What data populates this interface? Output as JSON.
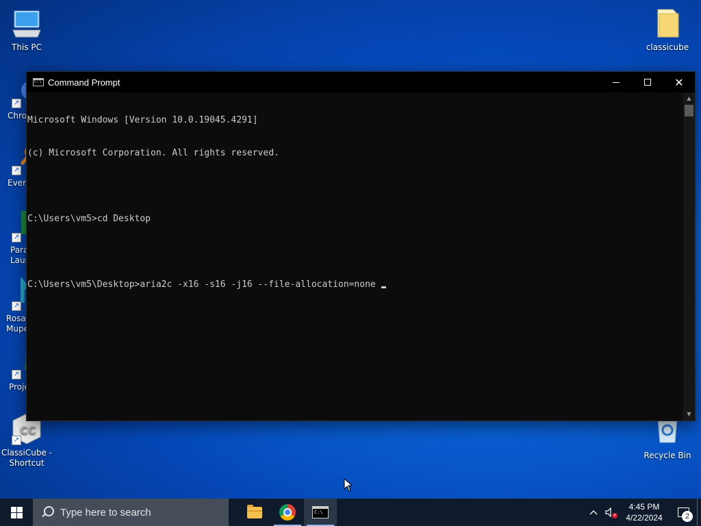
{
  "desktop": {
    "icons": [
      {
        "id": "this-pc",
        "label": "This PC"
      },
      {
        "id": "classicube-folder",
        "label": "classicube"
      },
      {
        "id": "chrome",
        "label": "Chro"
      },
      {
        "id": "everything",
        "label": "Every"
      },
      {
        "id": "para",
        "label": "Para\nLaun"
      },
      {
        "id": "rosa",
        "label": "Rosa\nMupe"
      },
      {
        "id": "proj",
        "label": "Proje"
      },
      {
        "id": "classicube-shortcut",
        "label": "ClassiCube -\nShortcut"
      },
      {
        "id": "recycle-bin",
        "label": "Recycle Bin"
      }
    ]
  },
  "window": {
    "title": "Command Prompt",
    "lines": [
      "Microsoft Windows [Version 10.0.19045.4291]",
      "(c) Microsoft Corporation. All rights reserved.",
      "",
      "C:\\Users\\vm5>cd Desktop",
      "",
      "C:\\Users\\vm5\\Desktop>aria2c -x16 -s16 -j16 --file-allocation=none "
    ]
  },
  "taskbar": {
    "search_placeholder": "Type here to search",
    "clock_time": "4:45 PM",
    "clock_date": "4/22/2024",
    "notification_count": "2"
  }
}
